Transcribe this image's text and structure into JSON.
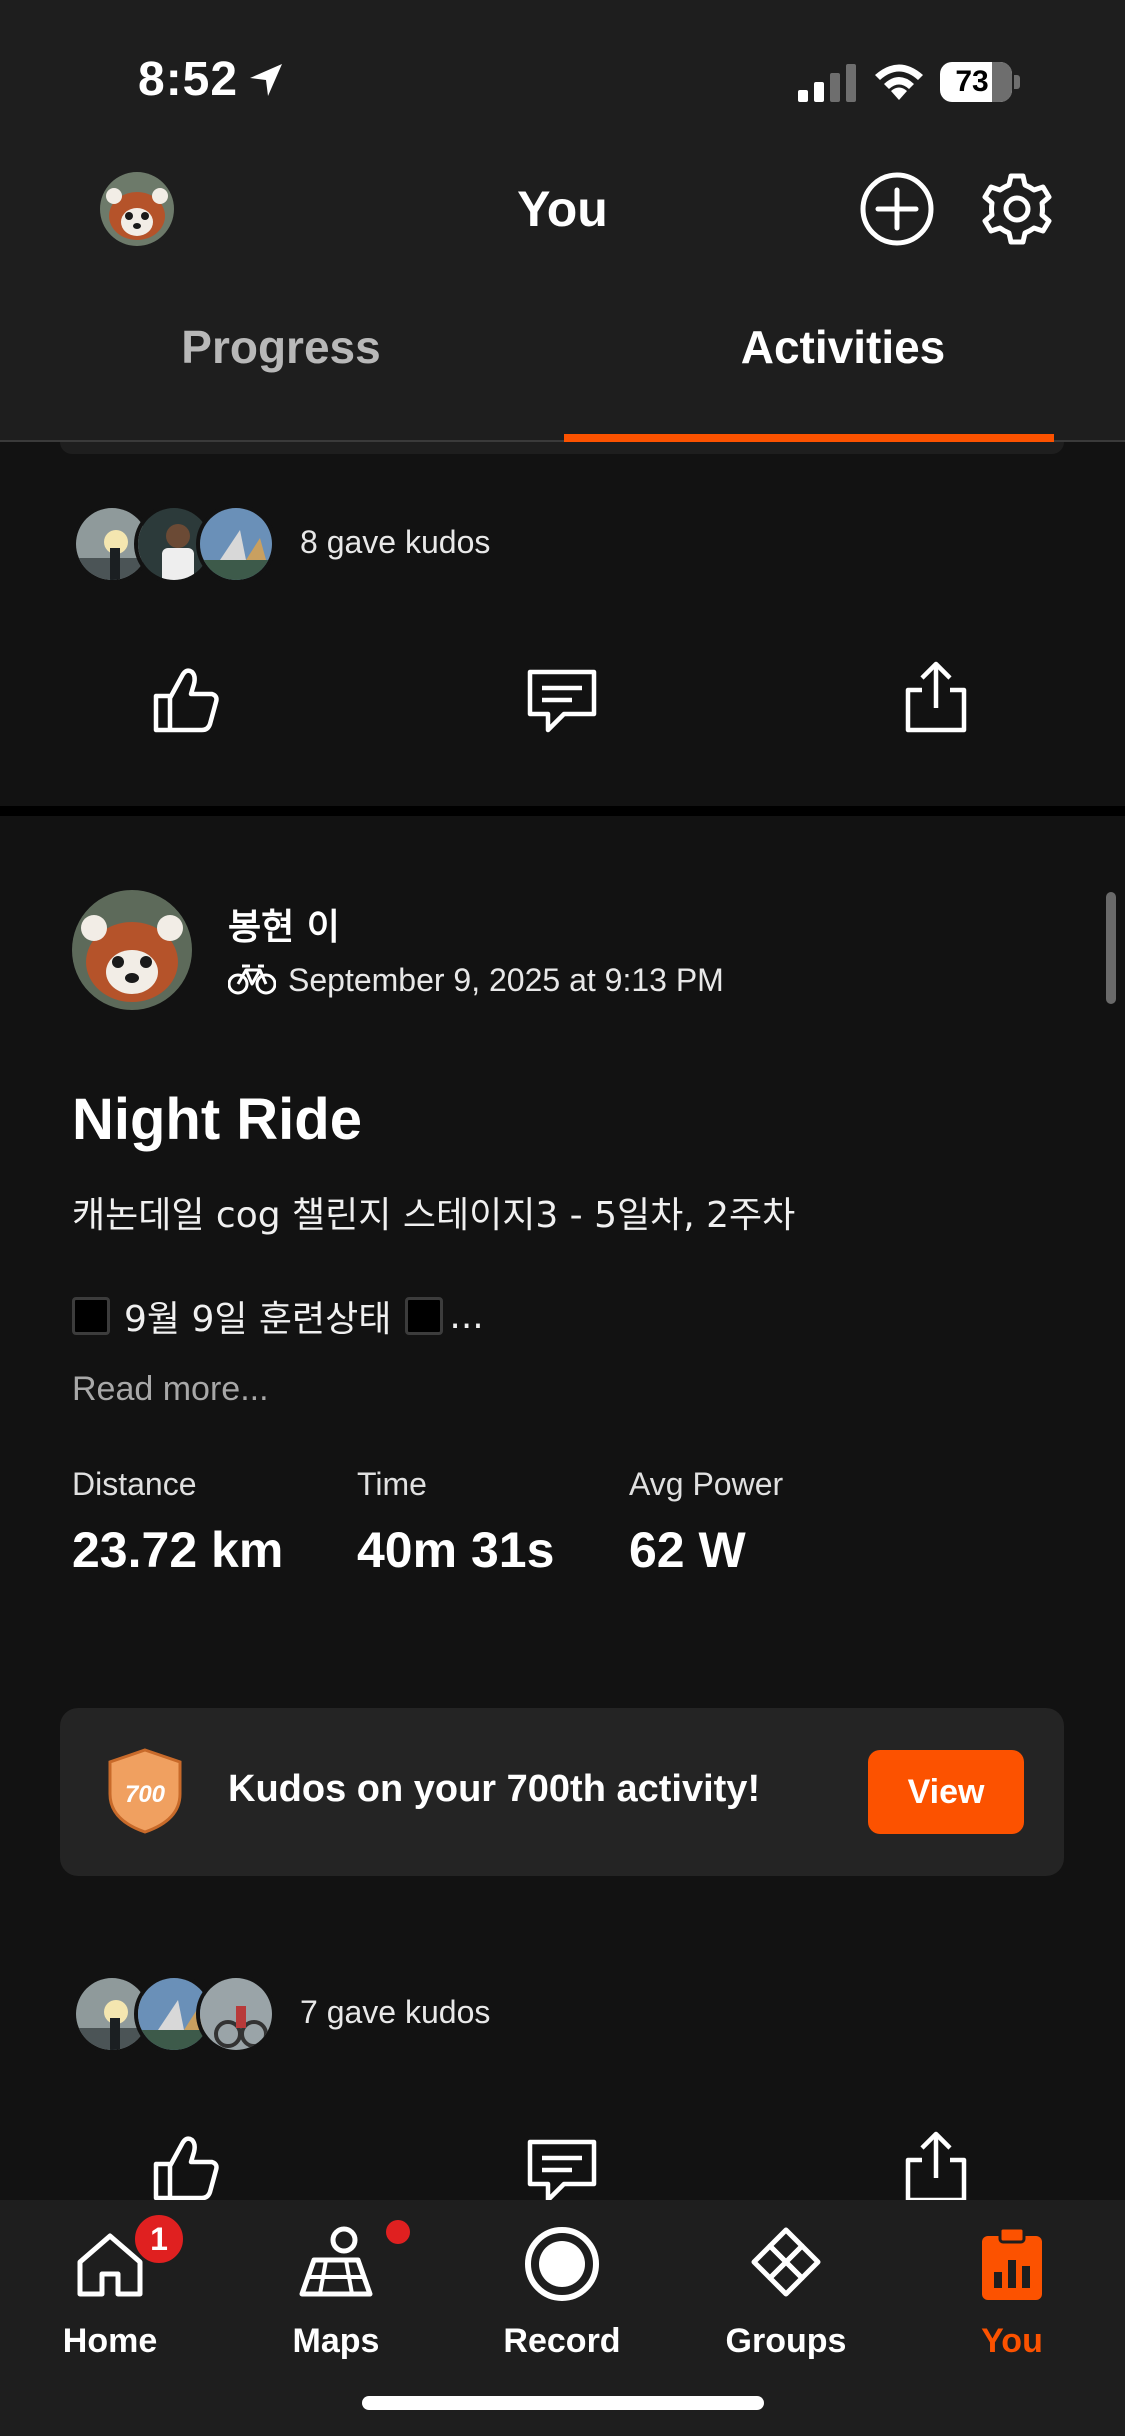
{
  "status_bar": {
    "time": "8:52",
    "battery": "73"
  },
  "header": {
    "title": "You"
  },
  "tabs": [
    {
      "label": "Progress",
      "selected": false
    },
    {
      "label": "Activities",
      "selected": true
    }
  ],
  "previous_card": {
    "kudos_text": "8 gave kudos"
  },
  "post": {
    "athlete_name": "봉현 이",
    "date": "September 9, 2025 at 9:13 PM",
    "title": "Night Ride",
    "description": "캐논데일 cog 챌린지 스테이지3 - 5일차, 2주차",
    "line2_text": "9월 9일 훈련상태",
    "line2_ellipsis": "...",
    "read_more": "Read more...",
    "stats": [
      {
        "label": "Distance",
        "value": "23.72 km"
      },
      {
        "label": "Time",
        "value": "40m 31s"
      },
      {
        "label": "Avg Power",
        "value": "62 W"
      }
    ],
    "milestone": {
      "badge": "700",
      "text": "Kudos on your 700th activity!",
      "button": "View"
    },
    "kudos_text": "7 gave kudos"
  },
  "bottom_nav": {
    "items": [
      {
        "label": "Home",
        "badge": "1"
      },
      {
        "label": "Maps"
      },
      {
        "label": "Record"
      },
      {
        "label": "Groups"
      },
      {
        "label": "You"
      }
    ]
  },
  "colors": {
    "accent": "#fc5200",
    "background": "#121212",
    "surface": "#1e1e1e",
    "badge_red": "#e02020"
  }
}
